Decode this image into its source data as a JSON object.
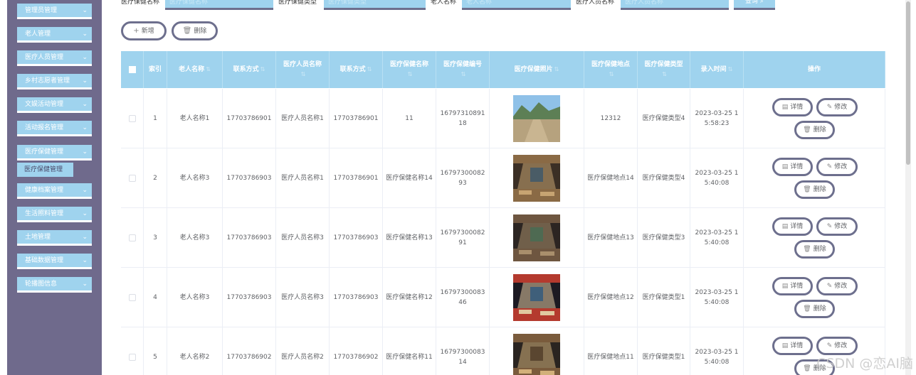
{
  "sidebar": {
    "items": [
      {
        "label": "管理员管理"
      },
      {
        "label": "老人管理"
      },
      {
        "label": "医疗人员管理"
      },
      {
        "label": "乡村志愿者管理"
      },
      {
        "label": "文娱活动管理"
      },
      {
        "label": "活动报名管理"
      },
      {
        "label": "医疗保健管理"
      },
      {
        "label": "健康档案管理"
      },
      {
        "label": "生活照料管理"
      },
      {
        "label": "土地管理"
      },
      {
        "label": "基础数据管理"
      },
      {
        "label": "轮播图信息"
      }
    ],
    "submenu_label": "医疗保健管理",
    "chevron": "⌄"
  },
  "search": {
    "fields": [
      {
        "label": "医疗保健名称",
        "placeholder": "医疗保健名称"
      },
      {
        "label": "医疗保健类型",
        "placeholder": "医疗保健类型"
      },
      {
        "label": "老人名称",
        "placeholder": "老人名称"
      },
      {
        "label": "医疗人员名称",
        "placeholder": "医疗人员名称"
      }
    ],
    "query_label": "查询",
    "query_icon": "⌕"
  },
  "toolbar": {
    "add_label": "新增",
    "add_icon": "+",
    "delete_label": "删除",
    "delete_icon": "🗑"
  },
  "table": {
    "headers": [
      "索引",
      "老人名称",
      "联系方式",
      "医疗人员名称",
      "联系方式",
      "医疗保健名称",
      "医疗保健编号",
      "医疗保健照片",
      "医疗保健地点",
      "医疗保健类型",
      "录入时间",
      "操作"
    ],
    "sort_glyph": "⇅",
    "rows": [
      {
        "index": "1",
        "elder": "老人名称1",
        "phone": "17703786901",
        "staff": "医疗人员名称1",
        "staff_phone": "17703786901",
        "name": "11",
        "code": "1679731089118",
        "place": "12312",
        "type": "医疗保健类型4",
        "time": "2023-03-25 15:58:23",
        "photo": "road"
      },
      {
        "index": "2",
        "elder": "老人名称3",
        "phone": "17703786903",
        "staff": "医疗人员名称1",
        "staff_phone": "17703786901",
        "name": "医疗保健名称14",
        "code": "1679730008293",
        "place": "医疗保健地点14",
        "type": "医疗保健类型4",
        "time": "2023-03-25 15:40:08",
        "photo": "interior-a"
      },
      {
        "index": "3",
        "elder": "老人名称3",
        "phone": "17703786903",
        "staff": "医疗人员名称3",
        "staff_phone": "17703786903",
        "name": "医疗保健名称13",
        "code": "1679730008291",
        "place": "医疗保健地点13",
        "type": "医疗保健类型3",
        "time": "2023-03-25 15:40:08",
        "photo": "interior-b"
      },
      {
        "index": "4",
        "elder": "老人名称3",
        "phone": "17703786903",
        "staff": "医疗人员名称3",
        "staff_phone": "17703786903",
        "name": "医疗保健名称12",
        "code": "1679730008346",
        "place": "医疗保健地点12",
        "type": "医疗保健类型1",
        "time": "2023-03-25 15:40:08",
        "photo": "interior-c"
      },
      {
        "index": "5",
        "elder": "老人名称2",
        "phone": "17703786902",
        "staff": "医疗人员名称2",
        "staff_phone": "17703786902",
        "name": "医疗保健名称11",
        "code": "1679730008314",
        "place": "医疗保健地点11",
        "type": "医疗保健类型1",
        "time": "2023-03-25 15:40:08",
        "photo": "interior-d"
      }
    ],
    "actions": {
      "detail": "详情",
      "edit": "修改",
      "delete": "删除",
      "detail_icon": "▤",
      "edit_icon": "✎",
      "delete_icon": "🗑"
    }
  },
  "watermark": "CSDN @恋AI脑",
  "colors": {
    "sidebar": "#6f6a8c",
    "accent": "#9fd3ee",
    "border": "#6d6f8d"
  }
}
